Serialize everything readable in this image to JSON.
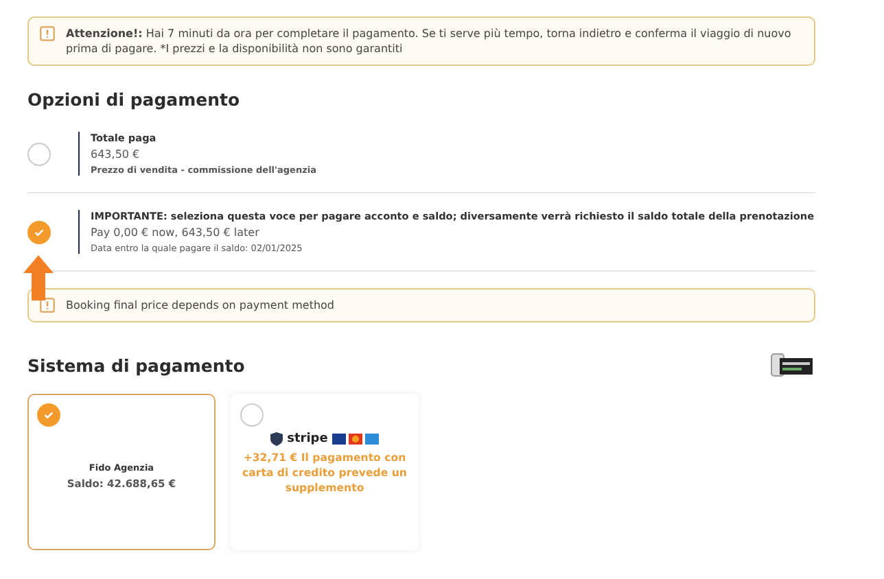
{
  "warning": {
    "bold": "Attenzione!:",
    "text": "Hai 7 minuti da ora per completare il pagamento. Se ti serve più tempo, torna indietro e conferma il viaggio di nuovo prima di pagare. *I prezzi e la disponibilità non sono garantiti"
  },
  "payment_options": {
    "title": "Opzioni di pagamento",
    "options": [
      {
        "title": "Totale paga",
        "amount": "643,50 €",
        "note": "Prezzo di vendita - commissione dell'agenzia",
        "selected": false
      },
      {
        "title": "IMPORTANTE: seleziona questa voce per pagare acconto e saldo; diversamente verrà richiesto il saldo totale della prenotazione",
        "amount": "Pay 0,00 € now, 643,50 € later",
        "note": "Data entro la quale pagare il saldo: 02/01/2025",
        "selected": true
      }
    ]
  },
  "notice": "Booking final price depends on payment method",
  "payment_system": {
    "title": "Sistema di pagamento",
    "methods": [
      {
        "kind": "credit",
        "name": "Fido Agenzia",
        "detail": "Saldo: 42.688,65 €",
        "selected": true
      },
      {
        "kind": "card",
        "logo": "stripe",
        "detail": "+32,71 € Il pagamento con carta di credito prevede un supplemento",
        "selected": false
      }
    ]
  }
}
